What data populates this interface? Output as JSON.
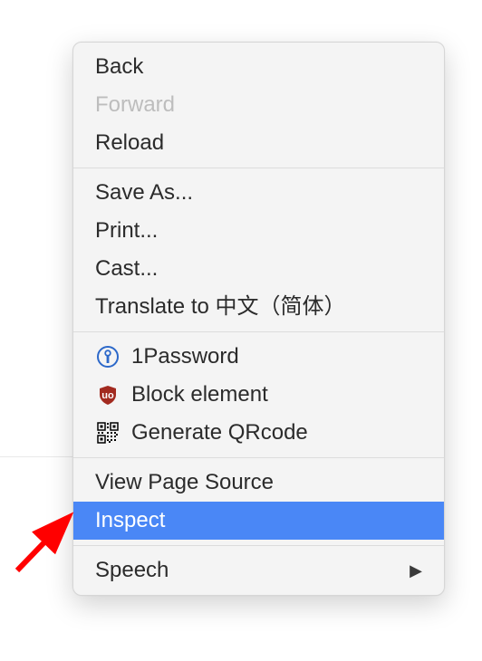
{
  "menu": {
    "items": [
      {
        "label": "Back",
        "disabled": false
      },
      {
        "label": "Forward",
        "disabled": true
      },
      {
        "label": "Reload",
        "disabled": false
      },
      {
        "label": "Save As...",
        "disabled": false
      },
      {
        "label": "Print...",
        "disabled": false
      },
      {
        "label": "Cast...",
        "disabled": false
      },
      {
        "label": "Translate to 中文（简体）",
        "disabled": false
      },
      {
        "label": "1Password",
        "disabled": false,
        "icon": "1password"
      },
      {
        "label": "Block element",
        "disabled": false,
        "icon": "ublock"
      },
      {
        "label": "Generate QRcode",
        "disabled": false,
        "icon": "qr"
      },
      {
        "label": "View Page Source",
        "disabled": false
      },
      {
        "label": "Inspect",
        "disabled": false,
        "highlighted": true
      },
      {
        "label": "Speech",
        "disabled": false,
        "submenu": true
      }
    ]
  },
  "colors": {
    "highlight": "#4a87f6",
    "menu_bg": "#f4f4f4",
    "text": "#2b2b2b",
    "disabled_text": "#bdbdbd",
    "arrow": "#ff0000"
  }
}
